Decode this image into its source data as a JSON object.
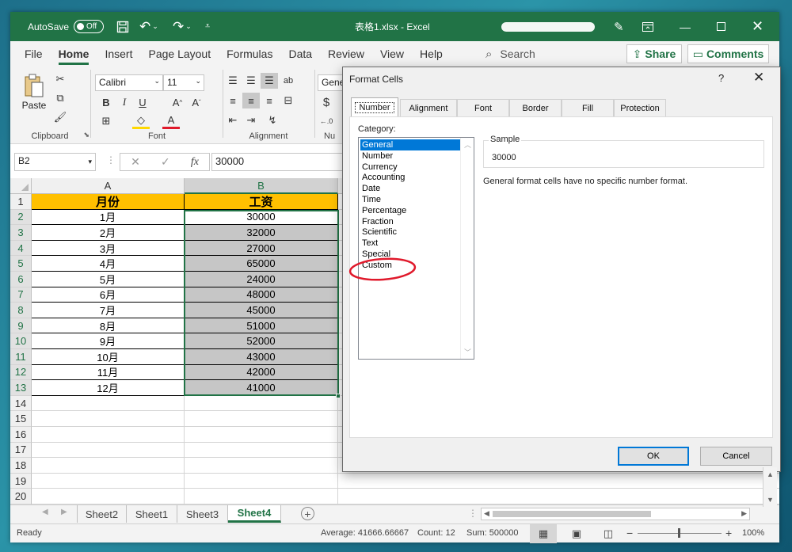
{
  "titlebar": {
    "autosave_label": "AutoSave",
    "autosave_state": "Off",
    "doc_title": "表格1.xlsx  -  Excel",
    "icons": [
      "save-icon",
      "undo-icon",
      "redo-icon",
      "customize-qat-icon",
      "pen-icon",
      "ribbon-display-icon",
      "minimize-icon",
      "maximize-icon",
      "close-icon"
    ]
  },
  "tabs": [
    "File",
    "Home",
    "Insert",
    "Page Layout",
    "Formulas",
    "Data",
    "Review",
    "View",
    "Help"
  ],
  "search_label": "Search",
  "share_label": "Share",
  "comments_label": "Comments",
  "ribbon": {
    "paste_label": "Paste",
    "font_name": "Calibri",
    "font_size": "11",
    "number_format_partial": "Gene",
    "groups": [
      "Clipboard",
      "Font",
      "Alignment",
      "Nu"
    ]
  },
  "formula_bar": {
    "name_box": "B2",
    "fx": "fx",
    "value": "30000"
  },
  "sheet": {
    "columns": [
      "A",
      "B"
    ],
    "header": [
      "月份",
      "工资"
    ],
    "rows": [
      [
        "1月",
        "30000"
      ],
      [
        "2月",
        "32000"
      ],
      [
        "3月",
        "27000"
      ],
      [
        "4月",
        "65000"
      ],
      [
        "5月",
        "24000"
      ],
      [
        "6月",
        "48000"
      ],
      [
        "7月",
        "45000"
      ],
      [
        "8月",
        "51000"
      ],
      [
        "9月",
        "52000"
      ],
      [
        "10月",
        "43000"
      ],
      [
        "11月",
        "42000"
      ],
      [
        "12月",
        "41000"
      ]
    ],
    "row_numbers": [
      "1",
      "2",
      "3",
      "4",
      "5",
      "6",
      "7",
      "8",
      "9",
      "10",
      "11",
      "12",
      "13",
      "14",
      "15",
      "16",
      "17",
      "18",
      "19",
      "20"
    ]
  },
  "sheet_tabs": [
    "Sheet2",
    "Sheet1",
    "Sheet3",
    "Sheet4"
  ],
  "active_sheet": "Sheet4",
  "status": {
    "ready": "Ready",
    "average": "Average: 41666.66667",
    "count": "Count: 12",
    "sum": "Sum: 500000",
    "zoom": "100%"
  },
  "dialog": {
    "title": "Format Cells",
    "help": "?",
    "tabs": [
      "Number",
      "Alignment",
      "Font",
      "Border",
      "Fill",
      "Protection"
    ],
    "category_label": "Category:",
    "categories": [
      "General",
      "Number",
      "Currency",
      "Accounting",
      "Date",
      "Time",
      "Percentage",
      "Fraction",
      "Scientific",
      "Text",
      "Special",
      "Custom"
    ],
    "selected_category": "General",
    "sample_label": "Sample",
    "sample_value": "30000",
    "description": "General format cells have no specific number format.",
    "ok": "OK",
    "cancel": "Cancel"
  },
  "colors": {
    "excel_green": "#217346",
    "header_fill": "#ffc000",
    "selection_fill": "#c6c6c6",
    "annotation_red": "#e0192b",
    "dialog_accent": "#0078d7"
  }
}
